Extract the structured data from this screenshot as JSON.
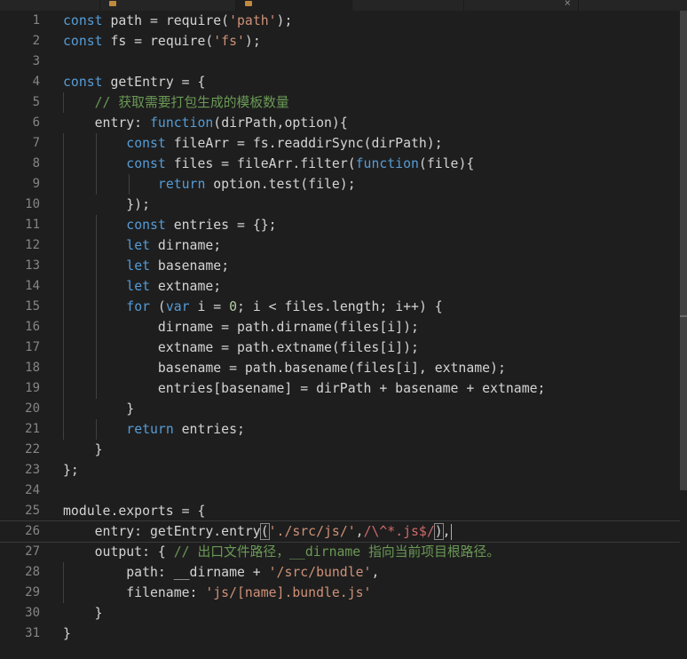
{
  "editor": {
    "tabs": [
      {
        "state": "inactive"
      },
      {
        "state": "active"
      },
      {
        "state": "inactive"
      },
      {
        "state": "inactive"
      }
    ],
    "colors": {
      "background": "#1e1e1e",
      "keyword": "#569cd6",
      "string": "#ce9178",
      "comment": "#6a9955",
      "number": "#b5cea8",
      "regex": "#d16969",
      "text": "#d4d4d4",
      "line_number": "#858585"
    },
    "current_line": 26,
    "line_numbers": [
      "1",
      "2",
      "3",
      "4",
      "5",
      "6",
      "7",
      "8",
      "9",
      "10",
      "11",
      "12",
      "13",
      "14",
      "15",
      "16",
      "17",
      "18",
      "19",
      "20",
      "21",
      "22",
      "23",
      "24",
      "25",
      "26",
      "27",
      "28",
      "29",
      "30",
      "31"
    ],
    "code": [
      [
        {
          "t": "const",
          "c": "kw"
        },
        {
          "t": " path = require("
        },
        {
          "t": "'path'",
          "c": "str"
        },
        {
          "t": ");"
        }
      ],
      [
        {
          "t": "const",
          "c": "kw"
        },
        {
          "t": " fs = require("
        },
        {
          "t": "'fs'",
          "c": "str"
        },
        {
          "t": ");"
        }
      ],
      [],
      [
        {
          "t": "const",
          "c": "kw"
        },
        {
          "t": " getEntry = {"
        }
      ],
      [
        {
          "t": "    "
        },
        {
          "t": "// 获取需要打包生成的模板数量",
          "c": "cm"
        }
      ],
      [
        {
          "t": "    entry: "
        },
        {
          "t": "function",
          "c": "kw"
        },
        {
          "t": "(dirPath,option){"
        }
      ],
      [
        {
          "t": "        "
        },
        {
          "t": "const",
          "c": "kw"
        },
        {
          "t": " fileArr = fs.readdirSync(dirPath);"
        }
      ],
      [
        {
          "t": "        "
        },
        {
          "t": "const",
          "c": "kw"
        },
        {
          "t": " files = fileArr.filter("
        },
        {
          "t": "function",
          "c": "kw"
        },
        {
          "t": "(file){"
        }
      ],
      [
        {
          "t": "            "
        },
        {
          "t": "return",
          "c": "kw"
        },
        {
          "t": " option.test(file);"
        }
      ],
      [
        {
          "t": "        });"
        }
      ],
      [
        {
          "t": "        "
        },
        {
          "t": "const",
          "c": "kw"
        },
        {
          "t": " entries = {};"
        }
      ],
      [
        {
          "t": "        "
        },
        {
          "t": "let",
          "c": "kw"
        },
        {
          "t": " dirname;"
        }
      ],
      [
        {
          "t": "        "
        },
        {
          "t": "let",
          "c": "kw"
        },
        {
          "t": " basename;"
        }
      ],
      [
        {
          "t": "        "
        },
        {
          "t": "let",
          "c": "kw"
        },
        {
          "t": " extname;"
        }
      ],
      [
        {
          "t": "        "
        },
        {
          "t": "for",
          "c": "kw"
        },
        {
          "t": " ("
        },
        {
          "t": "var",
          "c": "kw"
        },
        {
          "t": " i = "
        },
        {
          "t": "0",
          "c": "num"
        },
        {
          "t": "; i < files.length; i++) {"
        }
      ],
      [
        {
          "t": "            dirname = path.dirname(files[i]);"
        }
      ],
      [
        {
          "t": "            extname = path.extname(files[i]);"
        }
      ],
      [
        {
          "t": "            basename = path.basename(files[i], extname);"
        }
      ],
      [
        {
          "t": "            entries[basename] = dirPath + basename + extname;"
        }
      ],
      [
        {
          "t": "        }"
        }
      ],
      [
        {
          "t": "        "
        },
        {
          "t": "return",
          "c": "kw"
        },
        {
          "t": " entries;"
        }
      ],
      [
        {
          "t": "    }"
        }
      ],
      [
        {
          "t": "};"
        }
      ],
      [],
      [
        {
          "t": "module.exports = {"
        }
      ],
      [
        {
          "t": "    entry: getEntry.entry"
        },
        {
          "t": "(",
          "c": "bracket"
        },
        {
          "t": "'./src/js/'",
          "c": "str"
        },
        {
          "t": ","
        },
        {
          "t": "/\\^*.js$/",
          "c": "rx"
        },
        {
          "t": ")",
          "c": "bracket"
        },
        {
          "t": ",",
          "cursor": true
        }
      ],
      [
        {
          "t": "    output: { "
        },
        {
          "t": "// 出口文件路径，__dirname 指向当前项目根路径。",
          "c": "cm"
        }
      ],
      [
        {
          "t": "        path: __dirname + "
        },
        {
          "t": "'/src/bundle'",
          "c": "str"
        },
        {
          "t": ","
        }
      ],
      [
        {
          "t": "        filename: "
        },
        {
          "t": "'js/[name].bundle.js'",
          "c": "str"
        }
      ],
      [
        {
          "t": "    }"
        }
      ],
      [
        {
          "t": "}"
        }
      ]
    ]
  }
}
